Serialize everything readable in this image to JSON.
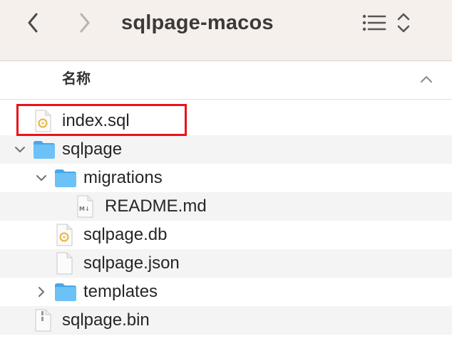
{
  "window": {
    "title": "sqlpage-macos"
  },
  "toolbar": {
    "back_icon": "chevron-left-icon",
    "forward_icon": "chevron-right-icon",
    "view_icon": "list-view-icon",
    "sort_icon": "up-down-chevron-icon"
  },
  "columns": {
    "name_header": "名称",
    "sort_icon": "chevron-up-icon"
  },
  "files": [
    {
      "name": "index.sql",
      "icon": "sql-file-icon",
      "depth": 0,
      "disclosure": "none"
    },
    {
      "name": "sqlpage",
      "icon": "folder-icon",
      "depth": 0,
      "disclosure": "expanded"
    },
    {
      "name": "migrations",
      "icon": "folder-icon",
      "depth": 1,
      "disclosure": "expanded"
    },
    {
      "name": "README.md",
      "icon": "markdown-file-icon",
      "depth": 2,
      "disclosure": "none"
    },
    {
      "name": "sqlpage.db",
      "icon": "db-file-icon",
      "depth": 1,
      "disclosure": "none"
    },
    {
      "name": "sqlpage.json",
      "icon": "document-icon",
      "depth": 1,
      "disclosure": "none"
    },
    {
      "name": "templates",
      "icon": "folder-icon",
      "depth": 1,
      "disclosure": "collapsed"
    },
    {
      "name": "sqlpage.bin",
      "icon": "binary-file-icon",
      "depth": 0,
      "disclosure": "none"
    }
  ],
  "colors": {
    "toolbar_bg": "#f6f0ec",
    "folder_blue": "#5bb6f2",
    "highlight_red": "#e8131b",
    "alt_row": "#f4f4f4"
  }
}
